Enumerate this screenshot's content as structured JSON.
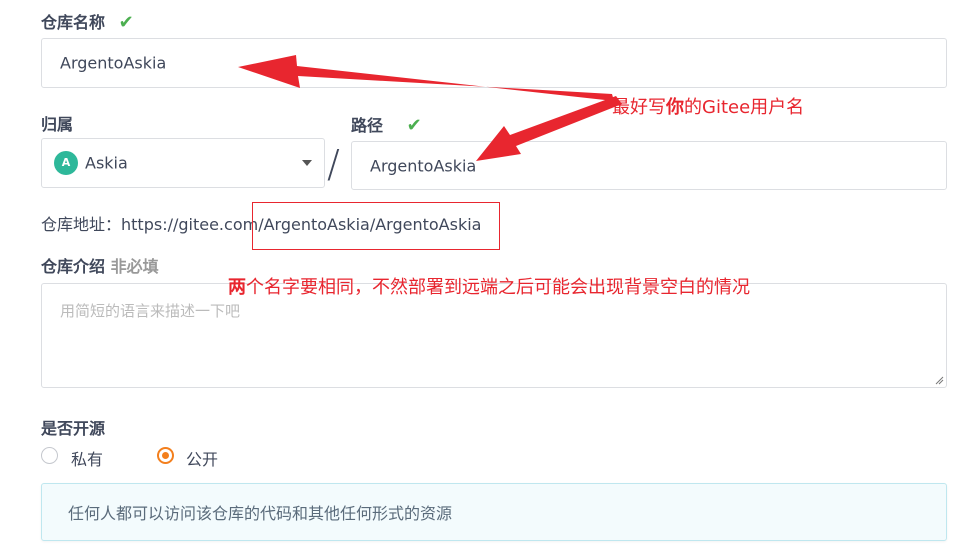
{
  "repo_name": {
    "label": "仓库名称",
    "value": "ArgentoAskia",
    "check_icon": "check-icon"
  },
  "owner": {
    "label": "归属",
    "avatar_letter": "A",
    "value": "Askia"
  },
  "separator": "/",
  "path": {
    "label": "路径",
    "value": "ArgentoAskia"
  },
  "repo_address": {
    "label": "仓库地址：",
    "prefix": "https://gitee.com",
    "path": "/ArgentoAskia/ArgentoAskia"
  },
  "description": {
    "label": "仓库介绍",
    "optional": "非必填",
    "placeholder": "用简短的语言来描述一下吧"
  },
  "open_source": {
    "label": "是否开源",
    "options": [
      {
        "label": "私有",
        "selected": false
      },
      {
        "label": "公开",
        "selected": true
      }
    ]
  },
  "info_message": "任何人都可以访问该仓库的代码和其他任何形式的资源",
  "annotations": {
    "tip1_part1": "最好写",
    "tip1_bold": "你",
    "tip1_part2": "的Gitee用户名",
    "tip2_bold": "两",
    "tip2_rest": "个名字要相同，不然部署到远端之后可能会出现背景空白的情况"
  },
  "colors": {
    "annotation_red": "#e8262f",
    "accent_orange": "#f37f1d",
    "check_green": "#4caf50"
  }
}
